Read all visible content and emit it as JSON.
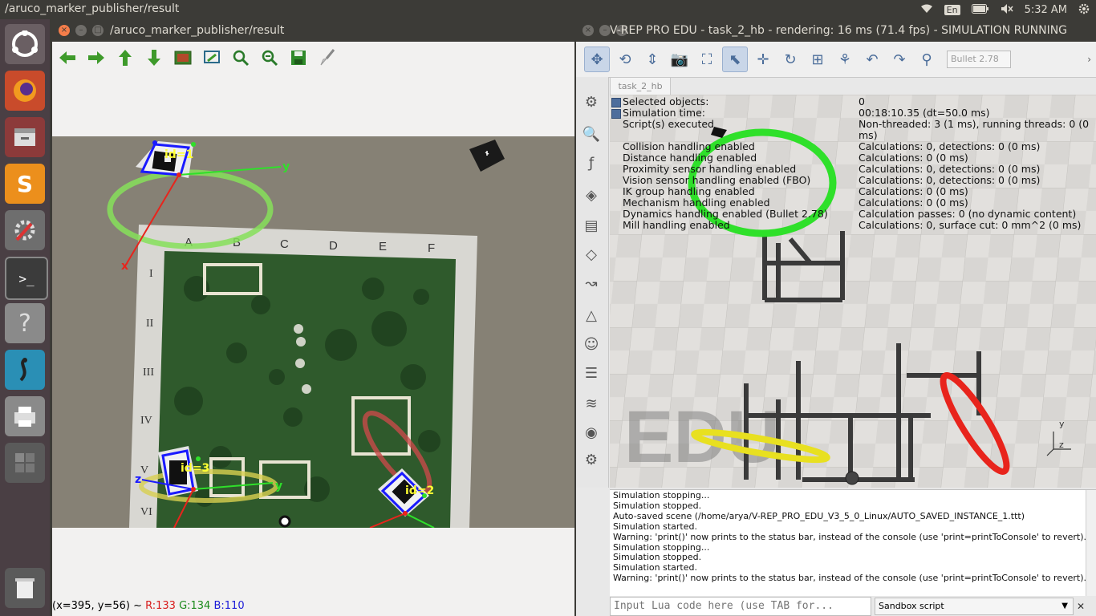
{
  "system": {
    "active_window_title": "/aruco_marker_publisher/result",
    "keyboard_layout": "En",
    "clock": "5:32 AM"
  },
  "launcher": {
    "items": [
      "ubuntu-dash",
      "firefox",
      "files",
      "sublime-text",
      "system-settings",
      "terminal",
      "help",
      "gazebo",
      "printer",
      "workspaces",
      "trash"
    ]
  },
  "rqt_window": {
    "title": "/aruco_marker_publisher/result",
    "toolbar": [
      "arrow-left-icon",
      "arrow-right-icon",
      "arrow-up-icon",
      "arrow-down-icon",
      "image-icon",
      "fit-icon",
      "zoom-in-icon",
      "zoom-out-icon",
      "save-icon",
      "brush-icon"
    ],
    "board": {
      "columns": [
        "A",
        "B",
        "C",
        "D",
        "E",
        "F"
      ],
      "rows": [
        "I",
        "II",
        "III",
        "IV",
        "V",
        "VI"
      ]
    },
    "markers": [
      {
        "label": "id=1"
      },
      {
        "label": "id=3"
      },
      {
        "label": "id=2"
      }
    ],
    "axis_labels": {
      "x": "x",
      "y": "y",
      "z": "z"
    },
    "status": {
      "coords": "(x=395, y=56) ~ ",
      "r": "R:133",
      "g": "G:134",
      "b": "B:110"
    }
  },
  "vrep_window": {
    "title": "V-REP PRO EDU - task_2_hb - rendering: 16 ms (71.4 fps) - SIMULATION RUNNING",
    "physics_engine": "Bullet 2.78",
    "scene_tab": "task_2_hb",
    "watermark": "EDU",
    "info": [
      {
        "label": "Selected objects:",
        "value": "0"
      },
      {
        "label": "Simulation time:",
        "value": "00:18:10.35 (dt=50.0 ms)"
      },
      {
        "label": "Script(s) executed",
        "value": "Non-threaded: 3 (1 ms), running threads: 0 (0 ms)"
      },
      {
        "label": "Collision handling enabled",
        "value": "Calculations: 0, detections: 0 (0 ms)"
      },
      {
        "label": "Distance handling enabled",
        "value": "Calculations: 0 (0 ms)"
      },
      {
        "label": "Proximity sensor handling enabled",
        "value": "Calculations: 0, detections: 0 (0 ms)"
      },
      {
        "label": "Vision sensor handling enabled (FBO)",
        "value": "Calculations: 0, detections: 0 (0 ms)"
      },
      {
        "label": "IK group handling enabled",
        "value": "Calculations: 0 (0 ms)"
      },
      {
        "label": "Mechanism handling enabled",
        "value": "Calculations: 0 (0 ms)"
      },
      {
        "label": "Dynamics handling enabled (Bullet 2.78)",
        "value": "Calculation passes: 0 (no dynamic content)"
      },
      {
        "label": "Mill handling enabled",
        "value": "Calculations: 0, surface cut: 0 mm^2 (0 ms)"
      }
    ],
    "console": [
      "Simulation stopping...",
      "Simulation stopped.",
      "Auto-saved scene (/home/arya/V-REP_PRO_EDU_V3_5_0_Linux/AUTO_SAVED_INSTANCE_1.ttt)",
      "Simulation started.",
      "Warning: 'print()' now prints to the status bar, instead of the console (use 'print=printToConsole' to revert).",
      "Simulation stopping...",
      "Simulation stopped.",
      "Simulation started.",
      "Warning: 'print()' now prints to the status bar, instead of the console (use 'print=printToConsole' to revert)."
    ],
    "lua_placeholder": "Input Lua code here (use TAB for...",
    "script_selector": "Sandbox script"
  },
  "colors": {
    "ring_green": "#2fe02a",
    "ring_red": "#e8241c",
    "ring_yellow": "#e8e020",
    "marker_blue": "#1a1aff",
    "label_yellow": "#ffff33"
  }
}
